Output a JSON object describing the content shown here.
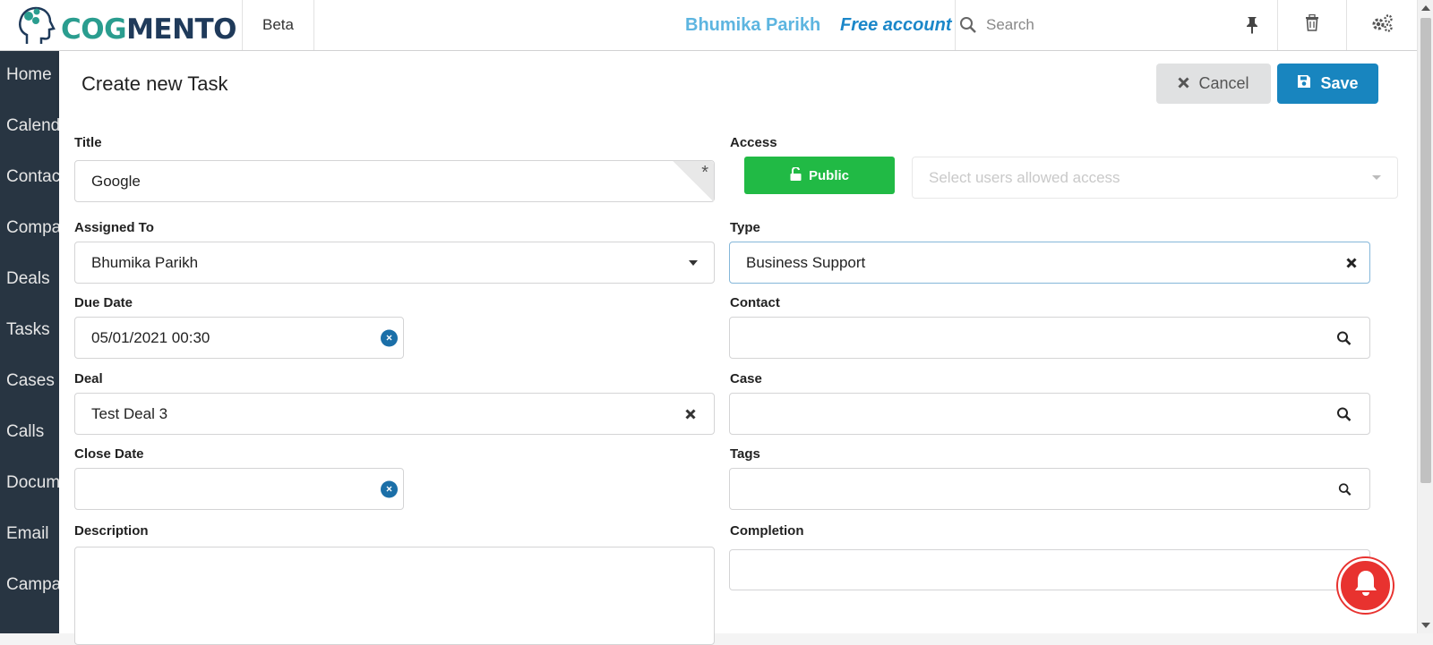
{
  "topbar": {
    "logo_text_cog": "COG",
    "logo_text_mento": "MENTO",
    "beta": "Beta",
    "user_name": "Bhumika Parikh",
    "account_type": "Free account",
    "search_placeholder": "Search"
  },
  "sidebar": {
    "items": [
      {
        "label": "Home",
        "icon": "home-icon"
      },
      {
        "label": "Calendar",
        "icon": "calendar-icon"
      },
      {
        "label": "Contacts",
        "icon": "contacts-icon"
      },
      {
        "label": "Companies",
        "icon": "companies-icon"
      },
      {
        "label": "Deals",
        "icon": "deals-icon"
      },
      {
        "label": "Tasks",
        "icon": "tasks-icon"
      },
      {
        "label": "Cases",
        "icon": "cases-icon"
      },
      {
        "label": "Calls",
        "icon": "calls-icon"
      },
      {
        "label": "Documents",
        "icon": "documents-icon"
      },
      {
        "label": "Email",
        "icon": "email-icon"
      },
      {
        "label": "Campaigns",
        "icon": "campaigns-icon"
      }
    ]
  },
  "header": {
    "title": "Create new Task",
    "cancel_label": "Cancel",
    "save_label": "Save"
  },
  "form": {
    "title": {
      "label": "Title",
      "value": "Google"
    },
    "access": {
      "label": "Access",
      "public_label": "Public",
      "users_placeholder": "Select users allowed access"
    },
    "assigned_to": {
      "label": "Assigned To",
      "value": "Bhumika Parikh"
    },
    "type": {
      "label": "Type",
      "value": "Business Support"
    },
    "due_date": {
      "label": "Due Date",
      "value": "05/01/2021 00:30"
    },
    "contact": {
      "label": "Contact",
      "value": ""
    },
    "deal": {
      "label": "Deal",
      "value": "Test Deal 3"
    },
    "case": {
      "label": "Case",
      "value": ""
    },
    "close_date": {
      "label": "Close Date",
      "value": ""
    },
    "tags": {
      "label": "Tags",
      "value": ""
    },
    "description": {
      "label": "Description",
      "value": ""
    },
    "completion": {
      "label": "Completion",
      "value": ""
    }
  },
  "colors": {
    "primary": "#1885bf",
    "public_green": "#21ba45",
    "sidebar_bg": "#283542",
    "notification_red": "#e8322f"
  }
}
